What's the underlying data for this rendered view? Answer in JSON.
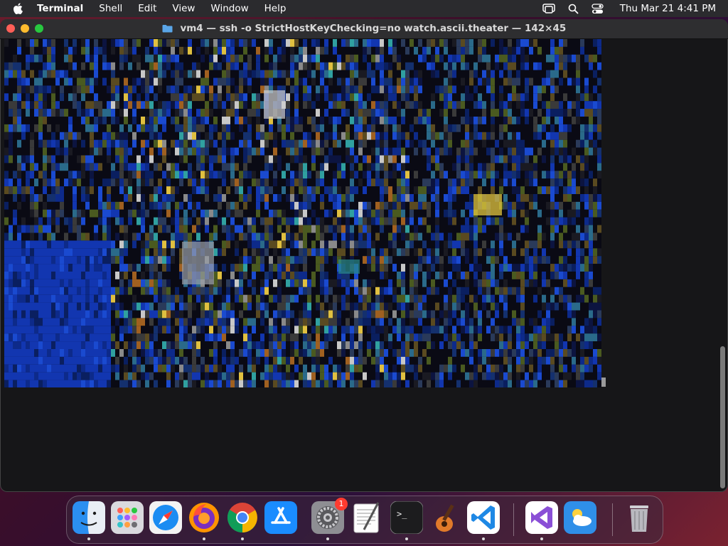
{
  "menubar": {
    "app_name": "Terminal",
    "items": [
      "Shell",
      "Edit",
      "View",
      "Window",
      "Help"
    ],
    "clock": "Thu Mar 21  4:41 PM"
  },
  "window": {
    "title": "vm4 — ssh -o StrictHostKeyChecking=no watch.ascii.theater — 142×45"
  },
  "dock": {
    "notification_badge": "1",
    "apps": [
      "finder",
      "launchpad",
      "safari",
      "firefox",
      "chrome",
      "app-store",
      "system-settings",
      "textedit",
      "terminal",
      "garageband",
      "vscode",
      "visual-studio",
      "weather",
      "trash"
    ]
  }
}
